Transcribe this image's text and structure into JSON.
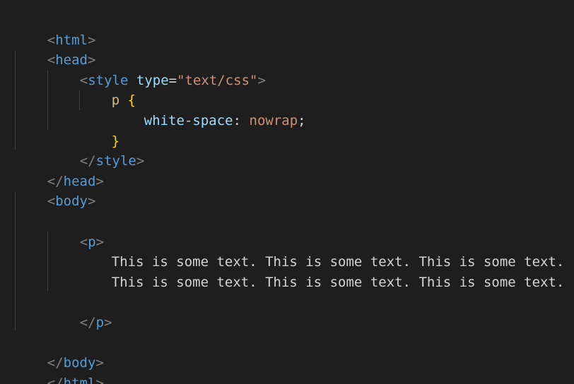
{
  "code": {
    "lines": [
      {
        "tag": "html"
      },
      {
        "tag": "head"
      },
      {
        "tag": "style",
        "attr_name": "type",
        "attr_value": "\"text/css\""
      },
      {
        "selector": "p",
        "brace": "{"
      },
      {
        "property": "white-space",
        "value": "nowrap"
      },
      {
        "brace": "}"
      },
      {
        "tag": "style"
      },
      {
        "tag": "head"
      },
      {
        "tag": "body"
      },
      {},
      {
        "tag": "p"
      },
      {
        "text": "This is some text. This is some text. This is some text."
      },
      {
        "text": "This is some text. This is some text. This is some text."
      },
      {},
      {
        "tag": "p"
      },
      {},
      {
        "tag": "body"
      },
      {
        "tag": "html"
      }
    ]
  },
  "colors": {
    "background": "#1e1e1e",
    "punctuation": "#808080",
    "tag": "#569cd6",
    "attribute": "#9cdcfe",
    "string": "#ce9178",
    "selector": "#d7ba7d",
    "brace": "#ffd700",
    "property": "#9cdcfe",
    "text": "#d4d4d4"
  }
}
